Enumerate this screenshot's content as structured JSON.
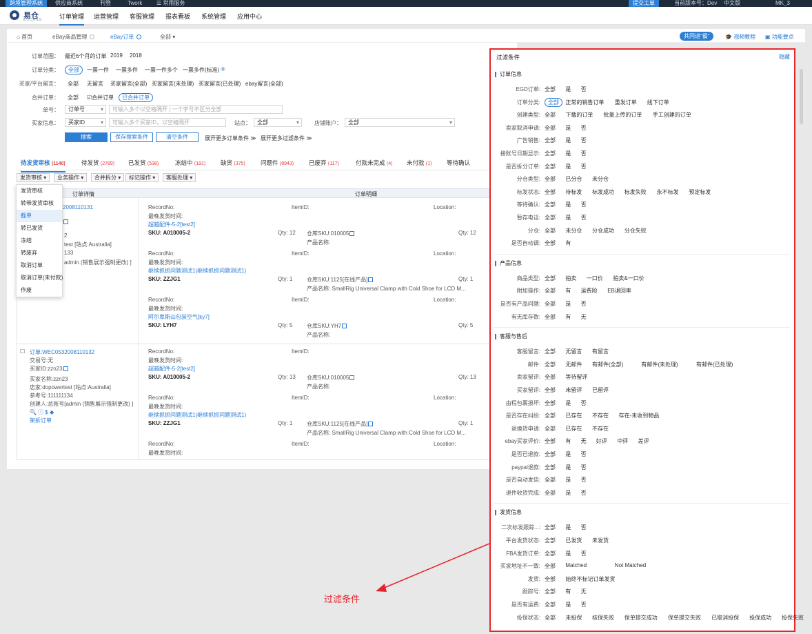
{
  "sysbar": {
    "items": [
      "跨境管理系统",
      "供应商系统",
      "刊登",
      "Twork",
      "☰ 常用服务"
    ],
    "ticket_btn": "提交工单",
    "version": "当前版本号：Dev",
    "lang": "中文版",
    "user": "MK_3"
  },
  "logo": {
    "name": "易仓",
    "sub": "ECCANG"
  },
  "nav": [
    "订单管理",
    "运营管理",
    "客服管理",
    "报表看板",
    "系统管理",
    "应用中心"
  ],
  "crumbs": [
    {
      "label": "首页"
    },
    {
      "label": "eBay商品管理"
    },
    {
      "label": "eBay订单"
    },
    {
      "label": "全部"
    }
  ],
  "crumb_right": {
    "share": "共同进“餐”",
    "video": "视频教程",
    "feature": "功能要点"
  },
  "filters": {
    "scope_label": "订单范围：",
    "scope_opts": [
      "最近6个月的订单",
      "2019",
      "2018"
    ],
    "cat_label": "订单分类：",
    "cat_opts": [
      "全部",
      "一票一件",
      "一票多件",
      "一票一件多个",
      "一票多件(标准)"
    ],
    "msg_label": "买家/平台留言：",
    "msg_opts": [
      "全部",
      "无留言",
      "买家留言(全部)",
      "买家留言(未处理)",
      "买家留言(已处理)",
      "ebay留言(全部)"
    ],
    "merge_label": "合并订单：",
    "merge_opts": [
      "全部",
      "☑合并订单",
      "已合并订单"
    ],
    "no_label": "单号：",
    "no_select": "订单号",
    "no_placeholder": "可输入多个以空格隔开 | 一个字号不区分全部",
    "buyer_label": "买家信息：",
    "buyer_select": "买家ID",
    "buyer_placeholder": "可输入多个买家ID，以空格隔开",
    "site_label": "站点：",
    "site_value": "全部",
    "store_label": "店铺账户：",
    "store_value": "全部",
    "search_btn": "搜索",
    "save_btn": "保存搜索条件",
    "clear_btn": "清空条件",
    "expand1": "展开更多订单条件 ≫",
    "expand2": "展开更多过滤条件 ≫"
  },
  "status_tabs": [
    {
      "label": "待发货审核",
      "count": "(1140)"
    },
    {
      "label": "待发货",
      "count": "(2789)"
    },
    {
      "label": "已发货",
      "count": "(538)"
    },
    {
      "label": "冻结中",
      "count": "(191)"
    },
    {
      "label": "缺货",
      "count": "(375)"
    },
    {
      "label": "问题件",
      "count": "(8943)"
    },
    {
      "label": "已废弃",
      "count": "(117)"
    },
    {
      "label": "付款未完成",
      "count": "(4)"
    },
    {
      "label": "未付款",
      "count": "(1)"
    },
    {
      "label": "等待确认",
      "count": ""
    }
  ],
  "op_buttons": [
    "发货审核 ▾",
    "业务操作 ▾",
    "合并拆分 ▾",
    "标记操作 ▾",
    "客服处理 ▾"
  ],
  "dropdown": [
    "发货审核",
    "转带发货审核",
    "截单",
    "转已发货",
    "冻结",
    "转废弃",
    "取消订单",
    "取消订单(未付款)",
    "作废"
  ],
  "table": {
    "col1": "订单详情",
    "col2": "订单明细"
  },
  "order1": {
    "no_tail": "2008110131",
    "line_frag1": "2",
    "line_frag2": "test [站点:Australia]",
    "line_frag3": "133",
    "line_frag4": "admin (销售展示强制更改) ]",
    "items": [
      {
        "rec": "RecordNo:",
        "ship": "最晚发货时间:",
        "title": "超越配件-5-2[test2]",
        "sku": "SKU: A010005-2",
        "itemid": "ItemID:",
        "loc": "Location:",
        "qty": "Qty: 12",
        "wsku": "仓库SKU:010005",
        "pname": "产品名称:",
        "qty2": "Qty: 12"
      },
      {
        "rec": "RecordNo:",
        "ship": "最晚发货时间:",
        "title": "继续抓抓问题测试1(继续抓抓问题测试1)",
        "sku": "SKU: ZZJG1",
        "itemid": "ItemID:",
        "loc": "Location:",
        "qty": "Qty: 1",
        "wsku": "仓库SKU:1125[在线产品]",
        "pname": "产品名称: SmallRig Universal Clamp with Cold Shoe for LCD M...",
        "qty2": "Qty: 1"
      },
      {
        "rec": "RecordNo:",
        "ship": "最晚发货时间:",
        "title": "阿尔卑斯山包装空气[ky7]",
        "sku": "SKU: LYH7",
        "itemid": "ItemID:",
        "loc": "Location:",
        "qty": "Qty: 5",
        "wsku": "仓库SKU:YH7",
        "pname": "产品名称:",
        "qty2": "Qty: 5"
      }
    ]
  },
  "order2": {
    "no": "订单:WEC0532008110132",
    "trade": "交易号:无",
    "buyer": "买家ID:zzn23",
    "bname": "买家名称:zzn23",
    "shop": "店家:dopowertest [站点:Australia]",
    "ref": "参考号:111111134",
    "creator": "创建人:总账号[admin (销售展示强制更改) ]",
    "split": "架拆订单",
    "items": [
      {
        "rec": "RecordNo:",
        "ship": "最晚发货时间:",
        "title": "超越配件-5-2[test2]",
        "sku": "SKU: A010005-2",
        "itemid": "ItemID:",
        "loc": "Location:",
        "qty": "Qty: 13",
        "wsku": "仓库SKU:010005",
        "pname": "产品名称:",
        "qty2": "Qty: 13"
      },
      {
        "rec": "RecordNo:",
        "ship": "最晚发货时间:",
        "title": "继续抓抓问题测试1(继续抓抓问题测试1)",
        "sku": "SKU: ZZJG1",
        "itemid": "ItemID:",
        "loc": "Location:",
        "qty": "Qty: 1",
        "wsku": "仓库SKU:1125[在线产品]",
        "pname": "产品名称: SmallRig Universal Clamp with Cold Shoe for LCD M...",
        "qty2": "Qty: 1"
      },
      {
        "rec": "RecordNo:",
        "ship": "最晚发货时间:",
        "title": "",
        "sku": "",
        "itemid": "ItemID:",
        "loc": "Location:",
        "qty": "",
        "wsku": "",
        "pname": "",
        "qty2": ""
      }
    ]
  },
  "filter_panel": {
    "title": "过滤条件",
    "hide": "隐藏",
    "sections": [
      {
        "title": "订单信息",
        "rows": [
          {
            "label": "EGD订单:",
            "opts": [
              "全部",
              "是",
              "否"
            ]
          },
          {
            "label": "订单分类:",
            "opts": [
              "全部",
              "正常的销售订单",
              "重发订单",
              "线下订单"
            ]
          },
          {
            "label": "创建类型:",
            "opts": [
              "全部",
              "下载的订单",
              "批量上传的订单",
              "手工创建的订单"
            ]
          },
          {
            "label": "卖家取消申请:",
            "opts": [
              "全部",
              "是",
              "否"
            ]
          },
          {
            "label": "广告销售:",
            "opts": [
              "全部",
              "是",
              "否"
            ]
          },
          {
            "label": "接账号日期显示:",
            "opts": [
              "全部",
              "是",
              "否"
            ]
          },
          {
            "label": "是否拆分订单:",
            "opts": [
              "全部",
              "是",
              "否"
            ]
          },
          {
            "label": "分仓类型:",
            "opts": [
              "全部",
              "已分仓",
              "未分仓"
            ]
          },
          {
            "label": "标发状态:",
            "opts": [
              "全部",
              "待标发",
              "标发成功",
              "标发失败",
              "永不标发",
              "预定标发"
            ]
          },
          {
            "label": "等待确认:",
            "opts": [
              "全部",
              "是",
              "否"
            ]
          },
          {
            "label": "暂存电话:",
            "opts": [
              "全部",
              "是",
              "否"
            ]
          },
          {
            "label": "分仓:",
            "opts": [
              "全部",
              "未分仓",
              "分仓成功",
              "分仓失败"
            ]
          },
          {
            "label": "是否自动调:",
            "opts": [
              "全部",
              "有"
            ]
          }
        ]
      },
      {
        "title": "产品信息",
        "rows": [
          {
            "label": "商品类型:",
            "opts": [
              "全部",
              "拍卖",
              "一口价",
              "拍卖&一口价"
            ]
          },
          {
            "label": "附加操作:",
            "opts": [
              "全部",
              "有",
              "运费险",
              "EB退回率"
            ]
          },
          {
            "label": "是否有产品问题:",
            "opts": [
              "全部",
              "是",
              "否"
            ]
          },
          {
            "label": "有无库存数:",
            "opts": [
              "全部",
              "有",
              "无"
            ]
          }
        ]
      },
      {
        "title": "客服与售后",
        "rows": [
          {
            "label": "客服留言:",
            "opts": [
              "全部",
              "无留言",
              "有留言"
            ]
          },
          {
            "label": "邮件:",
            "opts": [
              "全部",
              "无邮件",
              "有邮件(全部)",
              "有邮件(未处理)",
              "有邮件(已处理)"
            ]
          },
          {
            "label": "卖家留评:",
            "opts": [
              "全部",
              "等待留评"
            ]
          },
          {
            "label": "买家留评:",
            "opts": [
              "全部",
              "未留评",
              "已留评"
            ]
          },
          {
            "label": "由程包裹损坏:",
            "opts": [
              "全部",
              "是",
              "否"
            ]
          },
          {
            "label": "是否存在纠纷:",
            "opts": [
              "全部",
              "已存在",
              "不存在",
              "存在-未收到物品"
            ]
          },
          {
            "label": "退换货申请:",
            "opts": [
              "全部",
              "已存在",
              "不存在"
            ]
          },
          {
            "label": "ebay买家评价:",
            "opts": [
              "全部",
              "有",
              "无",
              "好评",
              "中评",
              "差评"
            ]
          },
          {
            "label": "是否已退款:",
            "opts": [
              "全部",
              "是",
              "否"
            ]
          },
          {
            "label": "paypal退款:",
            "opts": [
              "全部",
              "是",
              "否"
            ]
          },
          {
            "label": "是否自动发信:",
            "opts": [
              "全部",
              "是",
              "否"
            ]
          },
          {
            "label": "退件收货完成:",
            "opts": [
              "全部",
              "是",
              "否"
            ]
          }
        ]
      },
      {
        "title": "发货信息",
        "rows": [
          {
            "label": "二次标发跟踪...:",
            "opts": [
              "全部",
              "是",
              "否"
            ]
          },
          {
            "label": "平台发货状态:",
            "opts": [
              "全部",
              "已发货",
              "未发货"
            ]
          },
          {
            "label": "FBA发货订单:",
            "opts": [
              "全部",
              "是",
              "否"
            ]
          },
          {
            "label": "买家地址不一致:",
            "opts": [
              "全部",
              "Matched",
              "Not Matched"
            ]
          },
          {
            "label": "发货:",
            "opts": [
              "全部",
              "始终不标记订单发货"
            ]
          },
          {
            "label": "跟踪号:",
            "opts": [
              "全部",
              "有",
              "无"
            ]
          },
          {
            "label": "是否有运费:",
            "opts": [
              "全部",
              "是",
              "否"
            ]
          },
          {
            "label": "投保状态:",
            "opts": [
              "全部",
              "未投保",
              "核保失败",
              "保单提交成功",
              "保单提交失败",
              "已取消投保",
              "投保成功",
              "投保失败"
            ]
          }
        ]
      }
    ]
  },
  "annotation": "过滤条件",
  "colors": {
    "accent": "#2d7fd3",
    "alert": "#e5252c",
    "dark": "#1d2b3a"
  }
}
